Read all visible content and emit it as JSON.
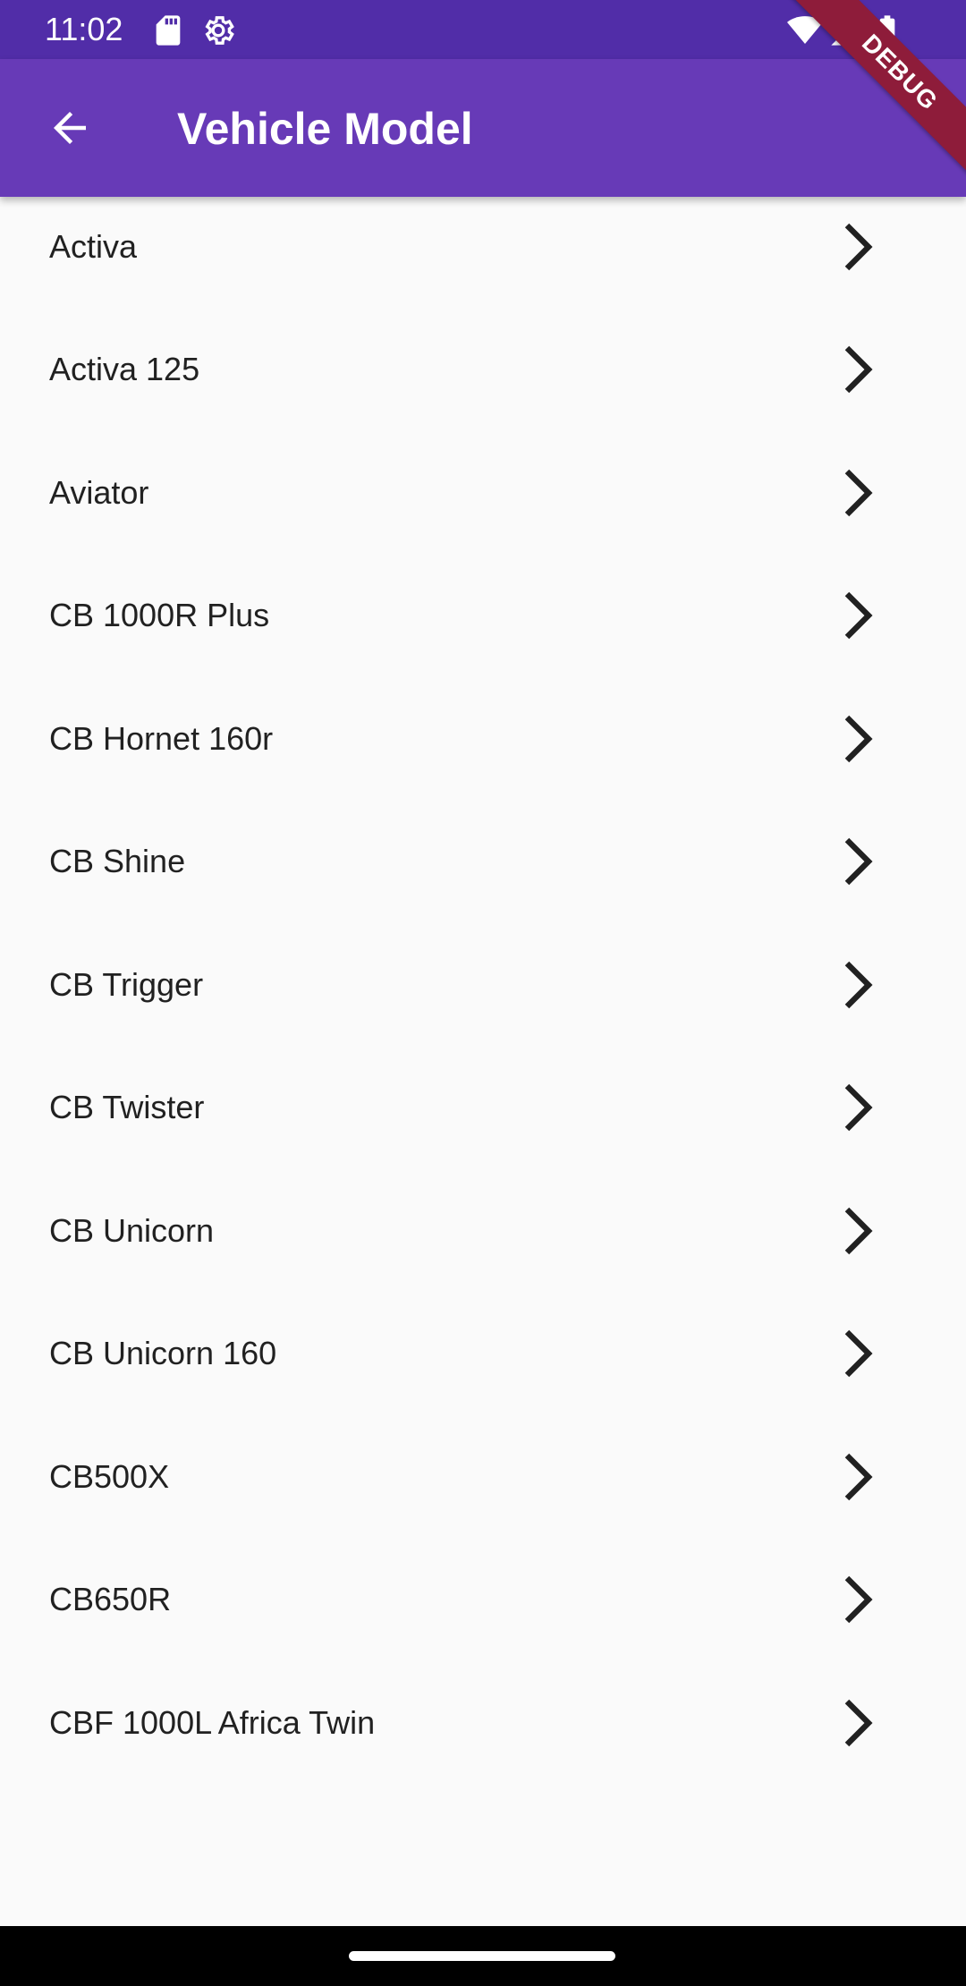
{
  "status_bar": {
    "time": "11:02",
    "icons_left": [
      "sd-card-icon",
      "settings-gear-icon"
    ],
    "icons_right": [
      "wifi-icon",
      "signal-icon",
      "battery-icon"
    ]
  },
  "app_bar": {
    "title": "Vehicle Model",
    "back_icon": "arrow-back-icon"
  },
  "debug_banner": "DEBUG",
  "models": [
    "Activa",
    "Activa 125",
    "Aviator",
    "CB 1000R Plus",
    "CB Hornet 160r",
    "CB Shine",
    "CB Trigger",
    "CB Twister",
    "CB Unicorn",
    "CB Unicorn 160",
    "CB500X",
    "CB650R",
    "CBF 1000L Africa Twin"
  ],
  "colors": {
    "status_bar": "#512da8",
    "app_bar": "#673ab7",
    "background": "#fafafa",
    "debug_ribbon": "#8e1c3a"
  }
}
